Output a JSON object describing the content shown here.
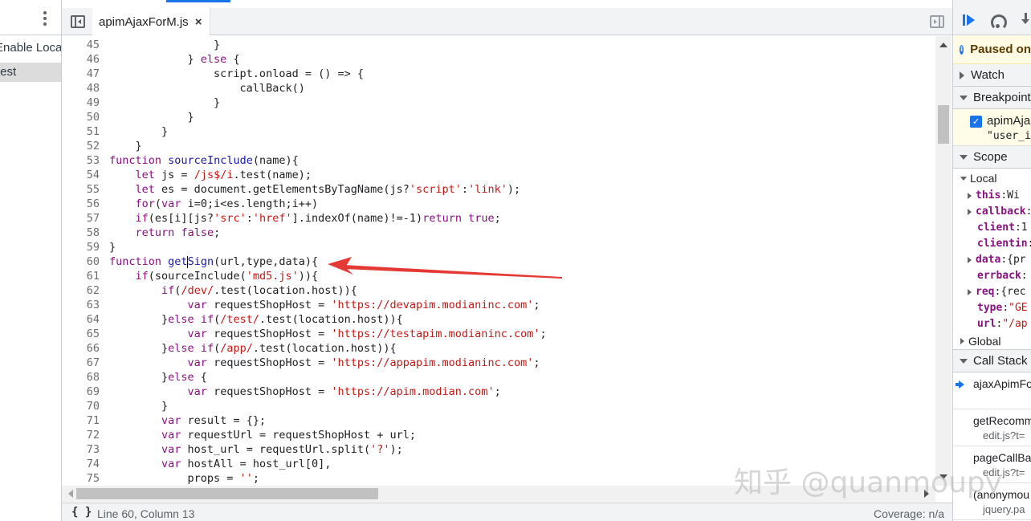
{
  "navigator": {
    "items": [
      {
        "label": "Enable Local"
      },
      {
        "label": "test"
      }
    ]
  },
  "editor": {
    "tab_label": "apimAjaxForM.js",
    "tab_close": "×",
    "current_line": 60
  },
  "code": [
    {
      "n": "45",
      "html": "                }"
    },
    {
      "n": "46",
      "html": "            } <span class=\"kw\">else</span> {"
    },
    {
      "n": "47",
      "html": "                script.onload = () => {"
    },
    {
      "n": "48",
      "html": "                    callBack()"
    },
    {
      "n": "49",
      "html": "                }"
    },
    {
      "n": "50",
      "html": "            }"
    },
    {
      "n": "51",
      "html": "        }"
    },
    {
      "n": "52",
      "html": "    }"
    },
    {
      "n": "53",
      "html": "<span class=\"kw\">function</span> <span class=\"fn\">sourceInclude</span>(name){"
    },
    {
      "n": "54",
      "html": "    <span class=\"kw\">let</span> js = <span class=\"re\">/js$/i</span>.test(name);"
    },
    {
      "n": "55",
      "html": "    <span class=\"kw\">let</span> es = document.getElementsByTagName(js?<span class=\"st\">'script'</span>:<span class=\"st\">'link'</span>);"
    },
    {
      "n": "56",
      "html": "    <span class=\"kw\">for</span>(<span class=\"kw\">var</span> i=0;i&lt;es.length;i++)"
    },
    {
      "n": "57",
      "html": "    <span class=\"kw\">if</span>(es[i][js?<span class=\"st\">'src'</span>:<span class=\"st\">'href'</span>].indexOf(name)!=-1)<span class=\"kw\">return</span> <span class=\"kw\">true</span>;"
    },
    {
      "n": "58",
      "html": "    <span class=\"kw\">return</span> <span class=\"kw\">false</span>;"
    },
    {
      "n": "59",
      "html": "}"
    },
    {
      "n": "60",
      "html": "<span class=\"kw\">function</span> <span class=\"fn\">get<span class=\"cursor-mark\"></span>Sign</span>(url,type,data){"
    },
    {
      "n": "61",
      "html": "    <span class=\"kw\">if</span>(sourceInclude(<span class=\"st\">'md5.js'</span>)){"
    },
    {
      "n": "62",
      "html": "        <span class=\"kw\">if</span>(<span class=\"re\">/dev/</span>.test(location.host)){"
    },
    {
      "n": "63",
      "html": "            <span class=\"kw\">var</span> requestShopHost = <span class=\"st\">'https://devapim.modianinc.com'</span>;"
    },
    {
      "n": "64",
      "html": "        }<span class=\"kw\">else</span> <span class=\"kw\">if</span>(<span class=\"re\">/test/</span>.test(location.host)){"
    },
    {
      "n": "65",
      "html": "            <span class=\"kw\">var</span> requestShopHost = <span class=\"st\">'https://testapim.modianinc.com'</span>;"
    },
    {
      "n": "66",
      "html": "        }<span class=\"kw\">else</span> <span class=\"kw\">if</span>(<span class=\"re\">/app/</span>.test(location.host)){"
    },
    {
      "n": "67",
      "html": "            <span class=\"kw\">var</span> requestShopHost = <span class=\"st\">'https://appapim.modianinc.com'</span>;"
    },
    {
      "n": "68",
      "html": "        }<span class=\"kw\">else</span> {"
    },
    {
      "n": "69",
      "html": "            <span class=\"kw\">var</span> requestShopHost = <span class=\"st\">'https://apim.modian.com'</span>;"
    },
    {
      "n": "70",
      "html": "        }"
    },
    {
      "n": "71",
      "html": "        <span class=\"kw\">var</span> result = {};"
    },
    {
      "n": "72",
      "html": "        <span class=\"kw\">var</span> requestUrl = requestShopHost + url;"
    },
    {
      "n": "73",
      "html": "        <span class=\"kw\">var</span> host_url = requestUrl.split(<span class=\"st\">'?'</span>);"
    },
    {
      "n": "74",
      "html": "        <span class=\"kw\">var</span> hostAll = host_url[0],"
    },
    {
      "n": "75",
      "html": "            props = <span class=\"st\">''</span>;"
    }
  ],
  "status": {
    "braces": "{ }",
    "position": "Line 60, Column 13",
    "coverage": "Coverage: n/a"
  },
  "debugger": {
    "paused": "Paused on",
    "info_glyph": "i",
    "watch": "Watch",
    "breakpoints": "Breakpoints",
    "bp_check": "✓",
    "bp_file": "apimAja",
    "bp_code": "\"user_i",
    "scope": "Scope",
    "local": "Local",
    "props": [
      {
        "key": "this",
        "val": "Wi",
        "expand": true,
        "str": false
      },
      {
        "key": "callback",
        "val": "",
        "expand": true,
        "str": false
      },
      {
        "key": "client",
        "val": "1",
        "expand": false,
        "str": false
      },
      {
        "key": "clientin",
        "val": "",
        "expand": false,
        "str": false
      },
      {
        "key": "data",
        "val": "{pr",
        "expand": true,
        "str": false
      },
      {
        "key": "errback",
        "val": "",
        "expand": false,
        "str": false
      },
      {
        "key": "req",
        "val": "{rec",
        "expand": true,
        "str": false
      },
      {
        "key": "type",
        "val": "\"GE",
        "expand": false,
        "str": true
      },
      {
        "key": "url",
        "val": "\"/ap",
        "expand": false,
        "str": true
      }
    ],
    "global": "Global",
    "call_stack": "Call Stack",
    "frames": [
      {
        "fn": "ajaxApimFo",
        "loc": ""
      },
      {
        "fn": "getRecomm",
        "loc": "edit.js?t="
      },
      {
        "fn": "pageCallBa",
        "loc": "edit.js?t="
      },
      {
        "fn": "(anonymou",
        "loc": "jquery.pa"
      }
    ]
  },
  "watermark": "知乎 @quanmoupy"
}
